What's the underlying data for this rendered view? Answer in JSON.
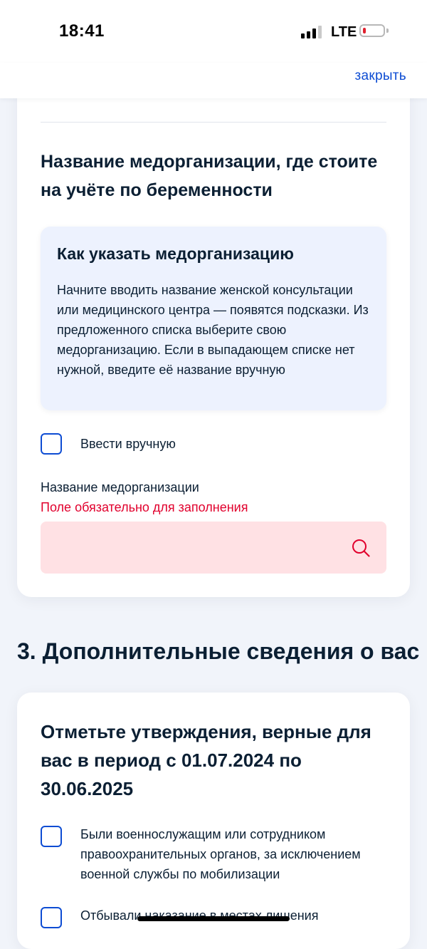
{
  "status_bar": {
    "time": "18:41",
    "network": "LTE"
  },
  "header": {
    "close_label": "закрыть"
  },
  "med_org_section": {
    "title": "Название медорганизации, где стоите на учёте по беременности",
    "hint": {
      "title": "Как указать медорганизацию",
      "text": "Начните вводить название женской консультации или медицинского центра — появятся подсказки. Из предложенного списка выберите свою медорганизацию. Если в выпадающем списке нет нужной, введите её название вручную"
    },
    "manual_checkbox": {
      "label": "Ввести вручную",
      "checked": false
    },
    "field": {
      "label": "Название медорганизации",
      "error": "Поле обязательно для заполнения",
      "value": "",
      "icon": "search-icon"
    }
  },
  "section3": {
    "title": "3. Дополнительные сведения о вас",
    "question": "Отметьте утверждения, верные для вас в период с 01.07.2024 по 30.06.2025",
    "options": [
      {
        "label": "Были военнослужащим или сотрудником правоохранительных органов, за исключением военной службы по мобилизации",
        "checked": false
      },
      {
        "label": "Отбывали наказание в местах лишения",
        "checked": false
      }
    ]
  },
  "colors": {
    "accent": "#0d4cd3",
    "error": "#e1002d",
    "error_bg": "#ffe1e4",
    "hint_bg": "#edf2fe",
    "text": "#0b1f33"
  }
}
